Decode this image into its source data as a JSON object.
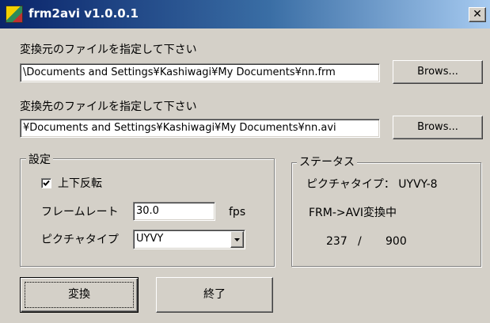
{
  "window": {
    "title": "frm2avi v1.0.0.1",
    "close_glyph": "✕"
  },
  "source": {
    "label": "変換元のファイルを指定して下さい",
    "value": "\\Documents and Settings¥Kashiwagi¥My Documents¥nn.frm",
    "browse_label": "Brows..."
  },
  "dest": {
    "label": "変換先のファイルを指定して下さい",
    "value": "¥Documents and Settings¥Kashiwagi¥My Documents¥nn.avi",
    "browse_label": "Brows..."
  },
  "settings": {
    "title": "設定",
    "flip_label": "上下反転",
    "flip_checked": true,
    "framerate_label": "フレームレート",
    "framerate_value": "30.0",
    "framerate_unit": "fps",
    "picture_type_label": "ピクチャタイプ",
    "picture_type_value": "UYVY"
  },
  "status": {
    "title": "ステータス",
    "picture_type_text": "ピクチャタイプ：  UYVY-8",
    "state_text": "FRM->AVI変換中",
    "progress_current": "237",
    "progress_sep": "/",
    "progress_total": "900"
  },
  "buttons": {
    "convert_label": "変換",
    "exit_label": "終了"
  }
}
